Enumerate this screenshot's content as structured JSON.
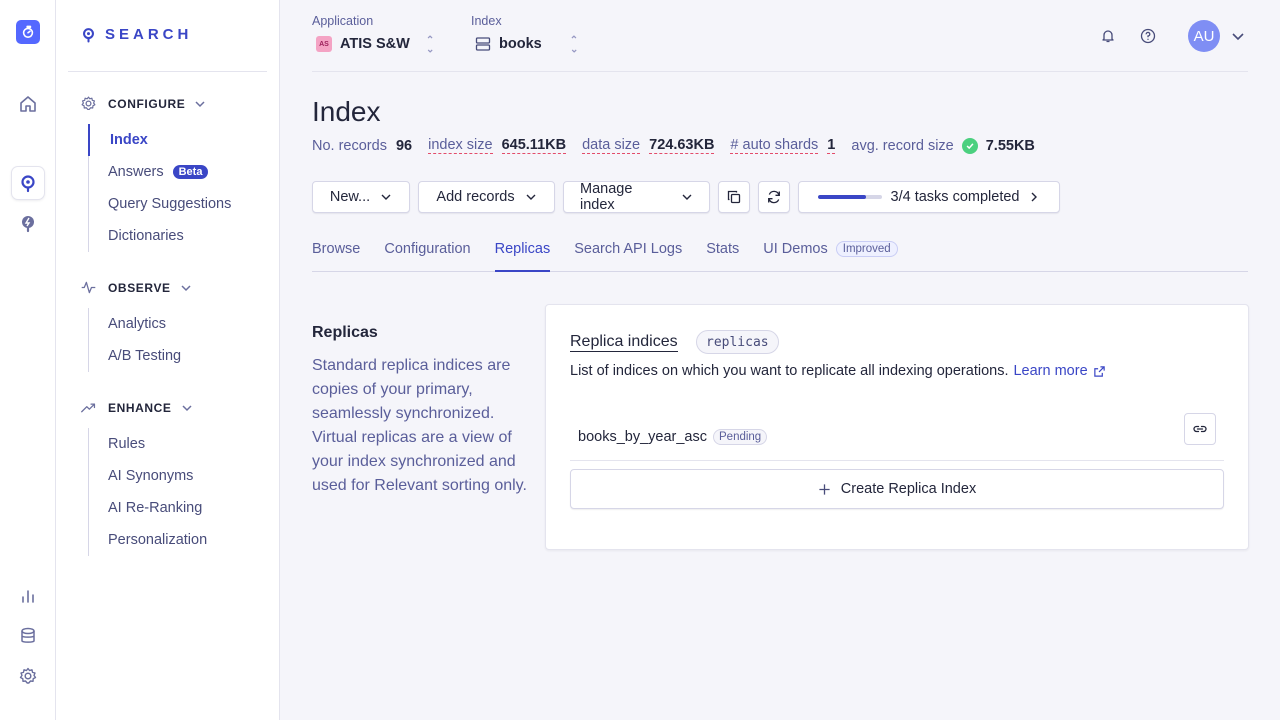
{
  "rail": {
    "icons": [
      "algolia-logo-icon",
      "home-icon",
      "search-product-icon",
      "generative-ai-icon",
      "analytics-bars-icon",
      "data-sources-icon",
      "settings-icon"
    ]
  },
  "sidebar": {
    "brand": "SEARCH",
    "sections": [
      {
        "label": "CONFIGURE",
        "icon": "gear-icon",
        "items": [
          "Index",
          "Answers",
          "Query Suggestions",
          "Dictionaries"
        ],
        "badge": "Beta"
      },
      {
        "label": "OBSERVE",
        "icon": "pulse-icon",
        "items": [
          "Analytics",
          "A/B Testing"
        ]
      },
      {
        "label": "ENHANCE",
        "icon": "trend-icon",
        "items": [
          "Rules",
          "AI Synonyms",
          "AI Re-Ranking",
          "Personalization"
        ]
      }
    ]
  },
  "topbar": {
    "application_label": "Application",
    "application_badge": "AS",
    "application_value": "ATIS S&W",
    "index_label": "Index",
    "index_value": "books",
    "avatar": "AU"
  },
  "page": {
    "title": "Index",
    "stats": {
      "records_label": "No. records",
      "records_value": "96",
      "index_size_label": "index size",
      "index_size_value": "645.11KB",
      "data_size_label": "data size",
      "data_size_value": "724.63KB",
      "shards_label": "# auto shards",
      "shards_value": "1",
      "avg_label": "avg. record size",
      "avg_value": "7.55KB"
    },
    "toolbar": {
      "new_label": "New...",
      "add_records_label": "Add records",
      "manage_label": "Manage index",
      "tasks_label": "3/4 tasks completed",
      "tasks_progress": 0.75
    },
    "tabs": [
      "Browse",
      "Configuration",
      "Replicas",
      "Search API Logs",
      "Stats",
      "UI Demos"
    ],
    "active_tab": "Replicas",
    "improved_badge": "Improved"
  },
  "replicas": {
    "section_title": "Replicas",
    "description": "Standard replica indices are copies of your primary, seamlessly synchronized. Virtual replicas are a view of your index synchronized and used for Relevant sorting only.",
    "card_title": "Replica indices",
    "code_tag": "replicas",
    "card_description": "List of indices on which you want to replicate all indexing operations.",
    "learn_more": "Learn more",
    "items": [
      {
        "name": "books_by_year_asc",
        "status": "Pending"
      }
    ],
    "create_label": "Create Replica Index"
  },
  "colors": {
    "accent": "#3a46c6",
    "brand": "#5468ff",
    "success": "#4bd07f",
    "warning_underline": "#e34c6a"
  }
}
